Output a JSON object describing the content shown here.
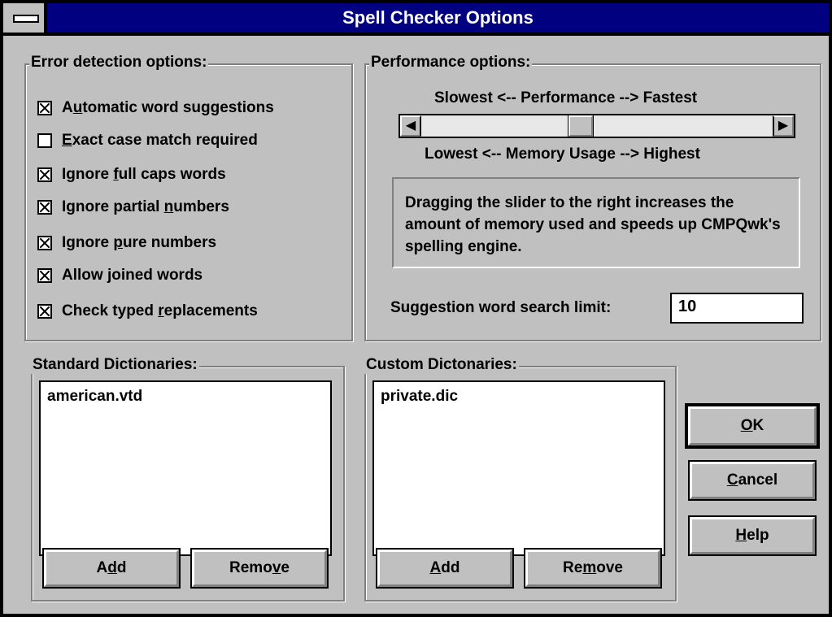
{
  "window": {
    "title": "Spell Checker Options"
  },
  "error_detection": {
    "label": "Error detection options:",
    "options": [
      {
        "pre": "A",
        "u": "u",
        "post": "tomatic word suggestions",
        "checked": true
      },
      {
        "pre": "",
        "u": "E",
        "post": "xact case match required",
        "checked": false
      },
      {
        "pre": "Ignore ",
        "u": "f",
        "post": "ull caps words",
        "checked": true
      },
      {
        "pre": "Ignore partial ",
        "u": "n",
        "post": "umbers",
        "checked": true
      },
      {
        "pre": "Ignore ",
        "u": "p",
        "post": "ure numbers",
        "checked": true
      },
      {
        "pre": "Allow ",
        "u": "j",
        "post": "oined words",
        "checked": true
      },
      {
        "pre": "Check typed ",
        "u": "r",
        "post": "eplacements",
        "checked": true
      }
    ]
  },
  "performance": {
    "label": "Performance options:",
    "top_label": "Slowest <-- Performance --> Fastest",
    "bottom_pre": "Lowest <-- Memory Usage --> Highest",
    "slider_fraction": 0.45,
    "info_text": "Dragging the slider to the right increases the amount of memory used and speeds up CMPQwk's spelling engine.",
    "limit_label_pre": "Su",
    "limit_label_u": "g",
    "limit_label_post": "gestion word search limit:",
    "limit_value": "10"
  },
  "standard_dicts": {
    "label": "Standard Dictionaries:",
    "items": [
      "american.vtd"
    ],
    "add": {
      "pre": "A",
      "u": "d",
      "post": "d"
    },
    "remove": {
      "pre": "Remo",
      "u": "v",
      "post": "e"
    }
  },
  "custom_dicts": {
    "label": "Custom Dictonaries:",
    "items": [
      "private.dic"
    ],
    "add": {
      "pre": "",
      "u": "A",
      "post": "dd"
    },
    "remove": {
      "pre": "Re",
      "u": "m",
      "post": "ove"
    }
  },
  "buttons": {
    "ok": {
      "pre": "",
      "u": "O",
      "post": "K"
    },
    "cancel": {
      "pre": "",
      "u": "C",
      "post": "ancel"
    },
    "help": {
      "pre": "",
      "u": "H",
      "post": "elp"
    }
  }
}
